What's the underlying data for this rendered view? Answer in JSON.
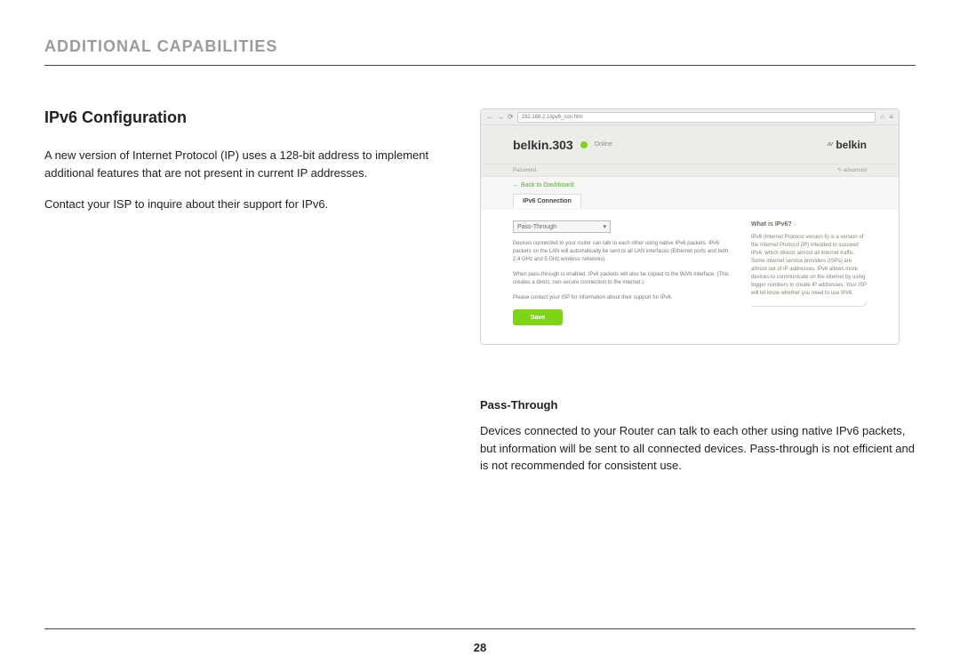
{
  "page": {
    "header": "ADDITIONAL CAPABILITIES",
    "number": "28"
  },
  "section": {
    "title": "IPv6 Configuration",
    "p1": "A new version of Internet Protocol (IP) uses a 128-bit address to implement additional features that are not present in current IP addresses.",
    "p2": "Contact your ISP to inquire about their support for IPv6."
  },
  "sub": {
    "title": "Pass-Through",
    "body": "Devices connected to your Router can talk to each other using native IPv6 packets, but information will be sent to all connected devices. Pass-through is not efficient and is not recommended for consistent use."
  },
  "shot": {
    "url": "192.168.2.1/ipv6_con.htm",
    "routerName": "belkin.303",
    "status": "Online",
    "password": "Password",
    "advanced": "✎ advanced",
    "brand": "belkin",
    "back": "← Back to Dashboard",
    "tab": "IPv6 Connection",
    "dropdown": "Pass-Through",
    "para1": "Devices connected to your router can talk to each other using native IPv6 packets. IPv6 packets on the LAN will automatically be sent to all LAN interfaces (Ethernet ports and both 2.4 GHz and 5 GHz wireless networks).",
    "para2": "When pass-through is enabled, IPv6 packets will also be copied to the WAN interface. (This creates a direct, non-secure connection to the internet.)",
    "para3": "Please contact your ISP for information about their support for IPv6.",
    "save": "Save",
    "help_title": "What is IPv6?",
    "help_body": "IPv6 (Internet Protocol version 6) is a version of the Internet Protocol (IP) intended to succeed IPv4, which directs almost all internet traffic. Some internet service providers (ISPs) are almost out of IP addresses. IPv6 allows more devices to communicate on the internet by using bigger numbers to create IP addresses. Your ISP will let know whether you need to use IPv6."
  }
}
